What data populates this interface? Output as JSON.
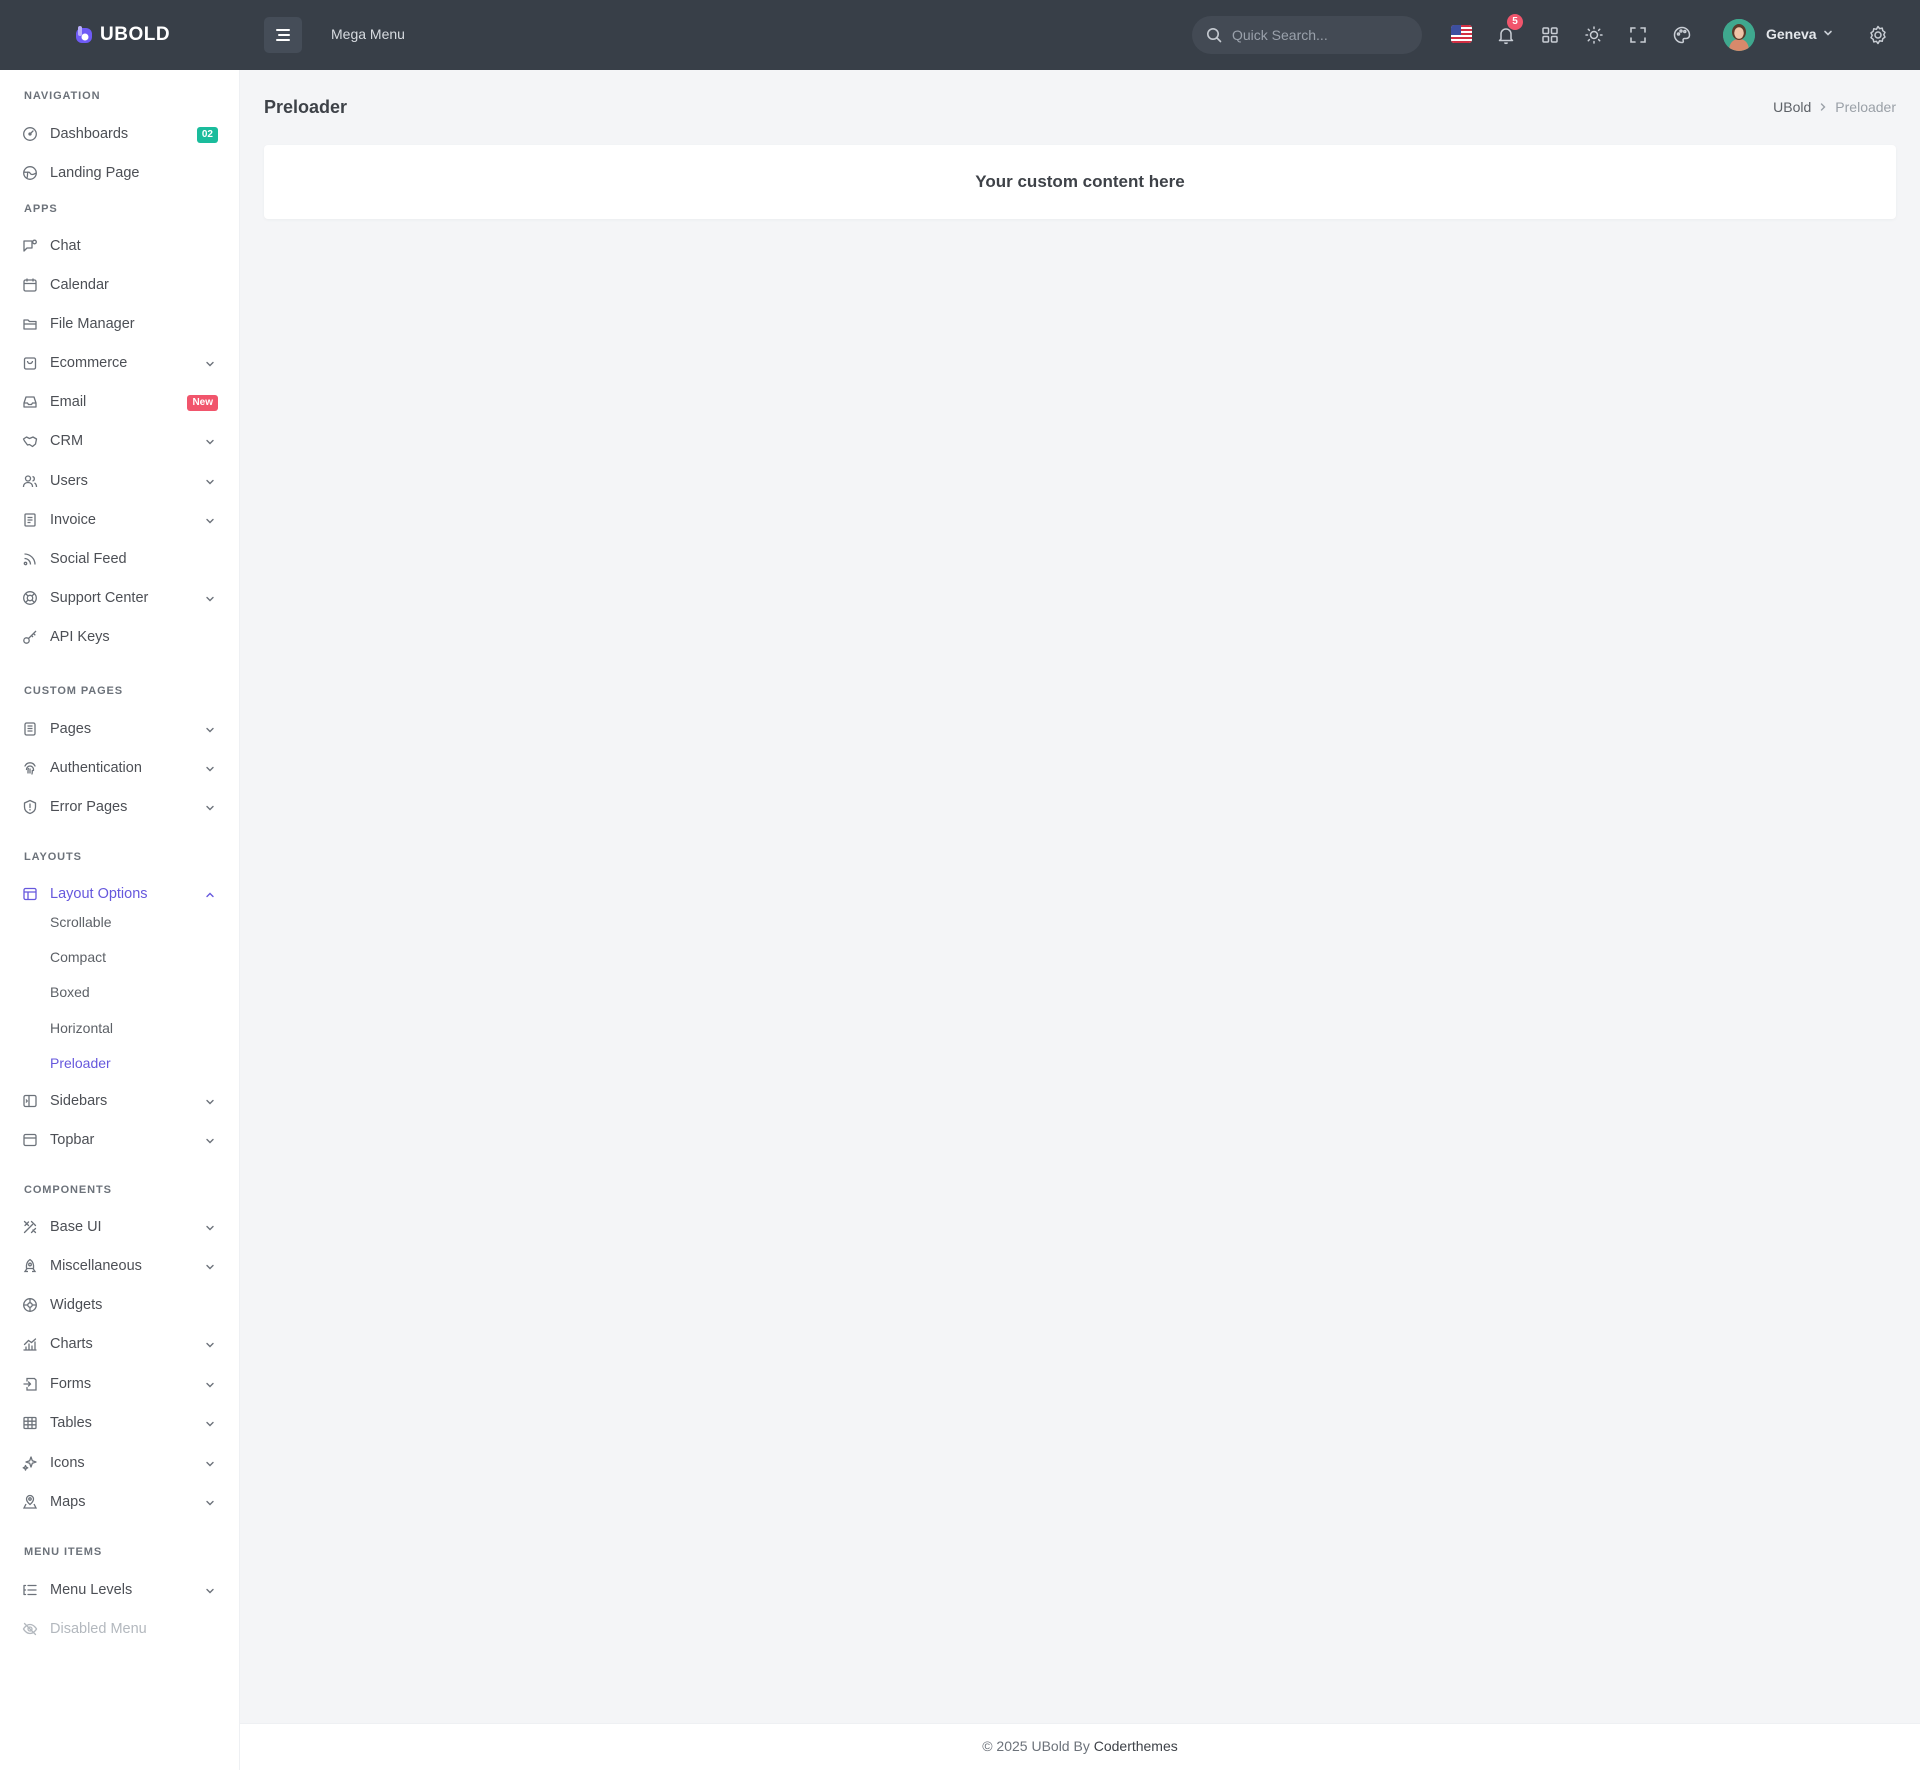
{
  "topbar": {
    "logo_text": "UBOLD",
    "mega_menu": "Mega Menu",
    "search_placeholder": "Quick Search...",
    "notification_count": "5",
    "user_name": "Geneva"
  },
  "sidebar": {
    "sections": {
      "navigation": "NAVIGATION",
      "apps": "APPS",
      "custom_pages": "CUSTOM PAGES",
      "layouts": "LAYOUTS",
      "components": "COMPONENTS",
      "menu_items": "MENU ITEMS"
    },
    "items": {
      "dashboards": {
        "label": "Dashboards",
        "badge": "02"
      },
      "landing_page": {
        "label": "Landing Page"
      },
      "chat": {
        "label": "Chat"
      },
      "calendar": {
        "label": "Calendar"
      },
      "file_manager": {
        "label": "File Manager"
      },
      "ecommerce": {
        "label": "Ecommerce"
      },
      "email": {
        "label": "Email",
        "badge": "New"
      },
      "crm": {
        "label": "CRM"
      },
      "users": {
        "label": "Users"
      },
      "invoice": {
        "label": "Invoice"
      },
      "social_feed": {
        "label": "Social Feed"
      },
      "support_center": {
        "label": "Support Center"
      },
      "api_keys": {
        "label": "API Keys"
      },
      "pages": {
        "label": "Pages"
      },
      "authentication": {
        "label": "Authentication"
      },
      "error_pages": {
        "label": "Error Pages"
      },
      "layout_options": {
        "label": "Layout Options"
      },
      "sidebars": {
        "label": "Sidebars"
      },
      "topbar": {
        "label": "Topbar"
      },
      "base_ui": {
        "label": "Base UI"
      },
      "miscellaneous": {
        "label": "Miscellaneous"
      },
      "widgets": {
        "label": "Widgets"
      },
      "charts": {
        "label": "Charts"
      },
      "forms": {
        "label": "Forms"
      },
      "tables": {
        "label": "Tables"
      },
      "icons": {
        "label": "Icons"
      },
      "maps": {
        "label": "Maps"
      },
      "menu_levels": {
        "label": "Menu Levels"
      },
      "disabled_menu": {
        "label": "Disabled Menu"
      }
    },
    "layout_sub": [
      "Scrollable",
      "Compact",
      "Boxed",
      "Horizontal",
      "Preloader"
    ]
  },
  "main": {
    "page_title": "Preloader",
    "breadcrumb": [
      "UBold",
      "Preloader"
    ],
    "card_text": "Your custom content here"
  },
  "footer": {
    "text": "© 2025 UBold By ",
    "brand": "Coderthemes"
  },
  "colors": {
    "topbar_bg": "#383f48",
    "accent": "#6658dd",
    "badge_teal": "#1abc9c",
    "badge_red": "#f1556c"
  }
}
